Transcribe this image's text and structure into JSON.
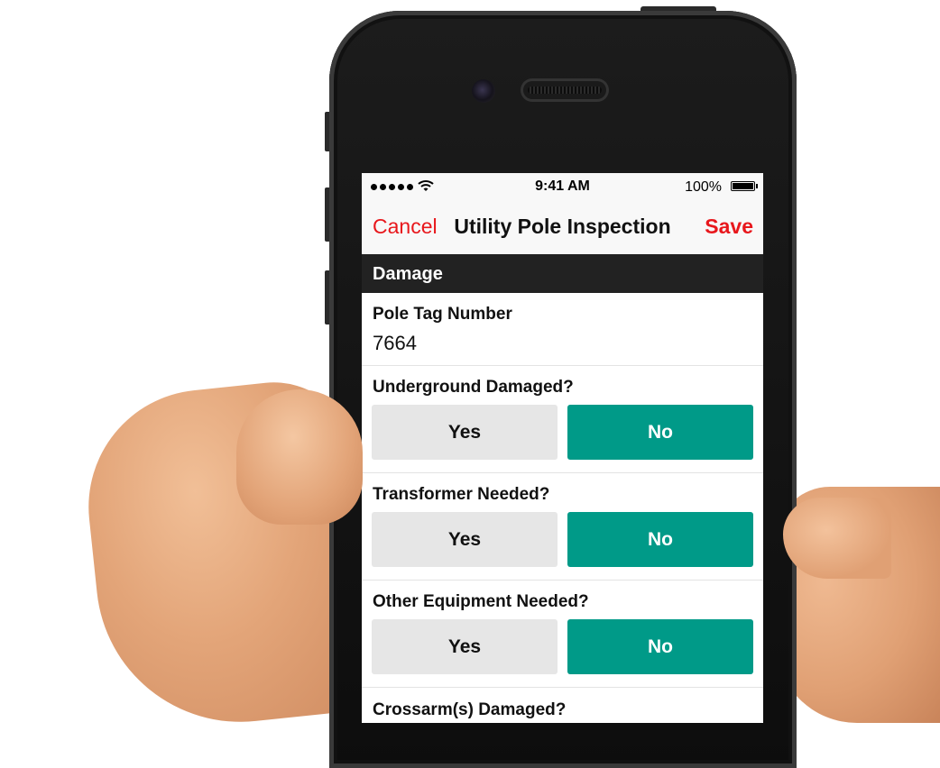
{
  "status_bar": {
    "time": "9:41 AM",
    "battery_percent": "100%",
    "signal_icon": "signal-dots-icon",
    "wifi_icon": "wifi-icon",
    "battery_icon": "battery-icon"
  },
  "nav": {
    "cancel_label": "Cancel",
    "title": "Utility Pole Inspection",
    "save_label": "Save"
  },
  "section": {
    "title": "Damage"
  },
  "fields": {
    "pole_tag": {
      "label": "Pole Tag Number",
      "value": "7664"
    },
    "underground": {
      "label": "Underground Damaged?",
      "yes": "Yes",
      "no": "No",
      "selected": "No"
    },
    "transformer": {
      "label": "Transformer Needed?",
      "yes": "Yes",
      "no": "No",
      "selected": "No"
    },
    "other_equipment": {
      "label": "Other Equipment Needed?",
      "yes": "Yes",
      "no": "No",
      "selected": "No"
    },
    "crossarm": {
      "label": "Crossarm(s) Damaged?"
    }
  },
  "colors": {
    "accent_red": "#e8171c",
    "selected_green": "#009a88",
    "unselected_gray": "#e6e6e6",
    "section_header": "#222222"
  }
}
